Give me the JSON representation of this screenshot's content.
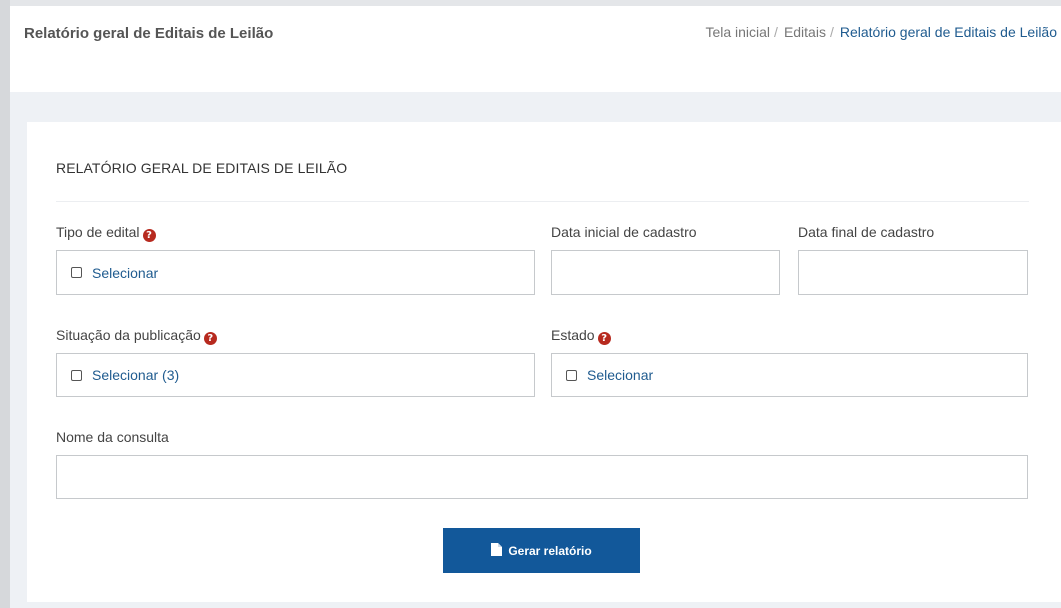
{
  "header": {
    "title": "Relatório geral de Editais de Leilão",
    "breadcrumb": [
      {
        "label": "Tela inicial"
      },
      {
        "label": "Editais"
      },
      {
        "label": "Relatório geral de Editais de Leilão"
      }
    ]
  },
  "form": {
    "section_title": "RELATÓRIO GERAL DE EDITAIS DE LEILÃO",
    "tipo_edital": {
      "label": "Tipo de edital",
      "value": "Selecionar"
    },
    "data_inicial": {
      "label": "Data inicial de cadastro",
      "value": ""
    },
    "data_final": {
      "label": "Data final de cadastro",
      "value": ""
    },
    "situacao": {
      "label": "Situação da publicação",
      "value": "Selecionar (3)"
    },
    "estado": {
      "label": "Estado",
      "value": "Selecionar"
    },
    "nome_consulta": {
      "label": "Nome da consulta",
      "value": ""
    },
    "submit_label": "Gerar relatório"
  },
  "icons": {
    "help": "question-circle-icon",
    "document": "file-icon"
  },
  "colors": {
    "link": "#1f5b8f",
    "primary_button": "#12589a",
    "help_icon": "#b72a1f",
    "content_bg": "#eef1f5"
  }
}
